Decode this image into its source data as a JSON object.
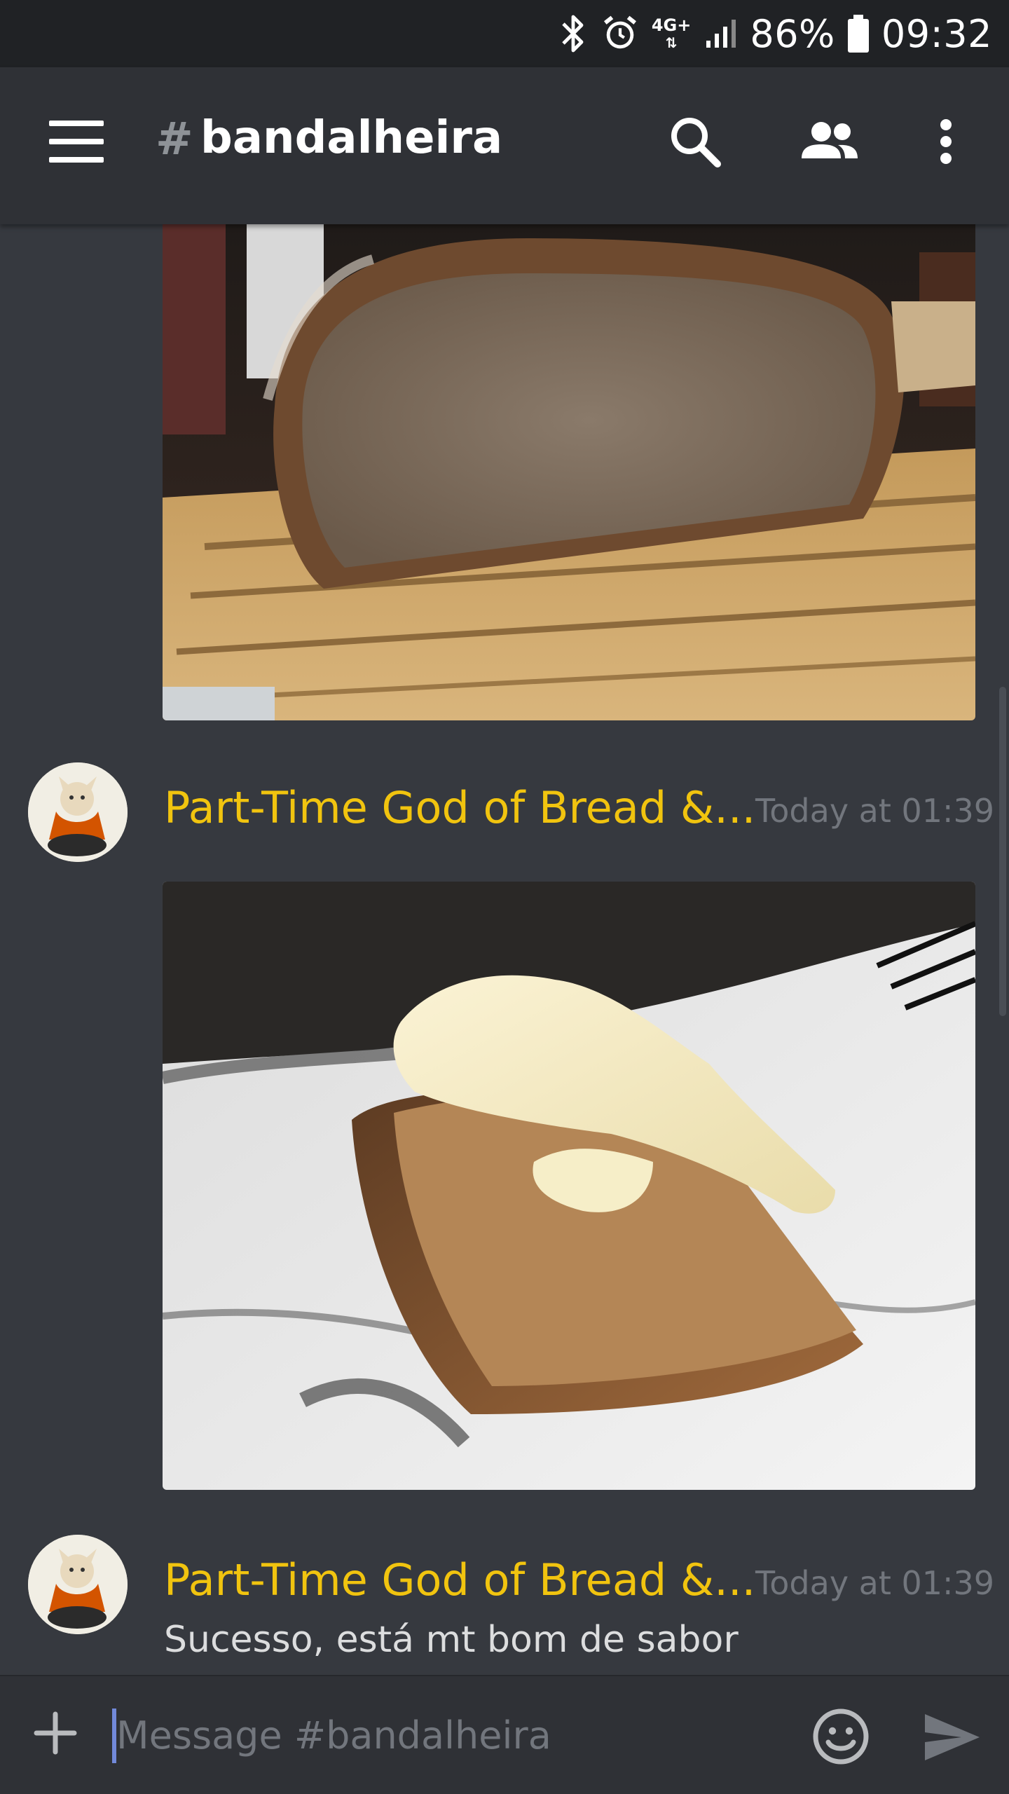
{
  "status_bar": {
    "network": "4G+",
    "battery": "86%",
    "time": "09:32",
    "icons": [
      "bluetooth-icon",
      "alarm-icon",
      "signal-icon",
      "battery-icon"
    ]
  },
  "header": {
    "hash": "#",
    "channel": "bandalheira",
    "icons": [
      "menu-icon",
      "search-icon",
      "members-icon",
      "more-vert-icon"
    ]
  },
  "messages": [
    {
      "author": "Part-Time God of Bread &...",
      "timestamp": "Today at 01:39",
      "attachment": "photo of a cut loaf of bread on a wooden board"
    },
    {
      "author": "Part-Time God of Bread &...",
      "timestamp": "Today at 01:39",
      "text": "Sucesso, está mt bom de sabor"
    }
  ],
  "composer": {
    "placeholder": "Message #bandalheira",
    "icons": [
      "plus-icon",
      "emoji-icon",
      "send-icon"
    ]
  },
  "colors": {
    "background": "#36393f",
    "app_bar": "#2f3136",
    "status_bar": "#202225",
    "author_name": "#f1c40f",
    "timestamp": "#72767d",
    "accent": "#7289da"
  }
}
